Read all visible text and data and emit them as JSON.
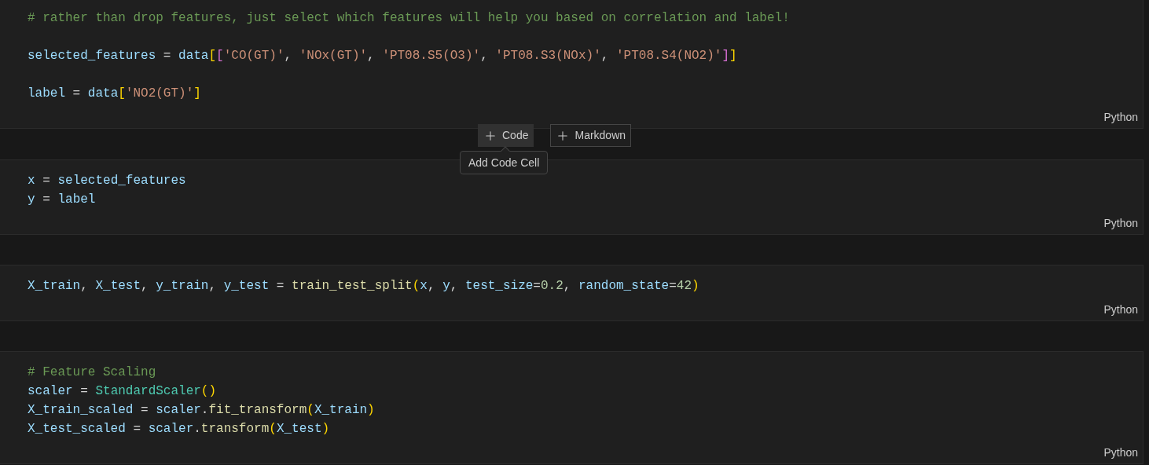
{
  "cells": [
    {
      "language": "Python",
      "lines": [
        {
          "kind": "code",
          "tokens": [
            {
              "kind": "comment",
              "text": "# rather than drop features, just select which features will help you based on correlation and label!"
            }
          ]
        },
        {
          "kind": "blank"
        },
        {
          "kind": "code",
          "tokens": [
            {
              "kind": "var",
              "text": "selected_features"
            },
            {
              "kind": "op",
              "text": " = "
            },
            {
              "kind": "var",
              "text": "data"
            },
            {
              "kind": "b1",
              "text": "["
            },
            {
              "kind": "b2",
              "text": "["
            },
            {
              "kind": "str",
              "text": "'CO(GT)'"
            },
            {
              "kind": "op",
              "text": ", "
            },
            {
              "kind": "str",
              "text": "'NOx(GT)'"
            },
            {
              "kind": "op",
              "text": ", "
            },
            {
              "kind": "str",
              "text": "'PT08.S5(O3)'"
            },
            {
              "kind": "op",
              "text": ", "
            },
            {
              "kind": "str",
              "text": "'PT08.S3(NOx)'"
            },
            {
              "kind": "op",
              "text": ", "
            },
            {
              "kind": "str",
              "text": "'PT08.S4(NO2)'"
            },
            {
              "kind": "b2",
              "text": "]"
            },
            {
              "kind": "b1",
              "text": "]"
            }
          ]
        },
        {
          "kind": "blank"
        },
        {
          "kind": "code",
          "tokens": [
            {
              "kind": "var",
              "text": "label"
            },
            {
              "kind": "op",
              "text": " = "
            },
            {
              "kind": "var",
              "text": "data"
            },
            {
              "kind": "b1",
              "text": "["
            },
            {
              "kind": "str",
              "text": "'NO2(GT)'"
            },
            {
              "kind": "b1",
              "text": "]"
            }
          ]
        }
      ]
    },
    {
      "language": "Python",
      "lines": [
        {
          "kind": "code",
          "tokens": [
            {
              "kind": "var",
              "text": "x"
            },
            {
              "kind": "op",
              "text": " = "
            },
            {
              "kind": "var",
              "text": "selected_features"
            }
          ]
        },
        {
          "kind": "code",
          "tokens": [
            {
              "kind": "var",
              "text": "y"
            },
            {
              "kind": "op",
              "text": " = "
            },
            {
              "kind": "var",
              "text": "label"
            }
          ]
        }
      ]
    },
    {
      "language": "Python",
      "lines": [
        {
          "kind": "code",
          "tokens": [
            {
              "kind": "var",
              "text": "X_train"
            },
            {
              "kind": "op",
              "text": ", "
            },
            {
              "kind": "var",
              "text": "X_test"
            },
            {
              "kind": "op",
              "text": ", "
            },
            {
              "kind": "var",
              "text": "y_train"
            },
            {
              "kind": "op",
              "text": ", "
            },
            {
              "kind": "var",
              "text": "y_test"
            },
            {
              "kind": "op",
              "text": " = "
            },
            {
              "kind": "fn",
              "text": "train_test_split"
            },
            {
              "kind": "b1",
              "text": "("
            },
            {
              "kind": "var",
              "text": "x"
            },
            {
              "kind": "op",
              "text": ", "
            },
            {
              "kind": "var",
              "text": "y"
            },
            {
              "kind": "op",
              "text": ", "
            },
            {
              "kind": "var",
              "text": "test_size"
            },
            {
              "kind": "op",
              "text": "="
            },
            {
              "kind": "num",
              "text": "0.2"
            },
            {
              "kind": "op",
              "text": ", "
            },
            {
              "kind": "var",
              "text": "random_state"
            },
            {
              "kind": "op",
              "text": "="
            },
            {
              "kind": "num",
              "text": "42"
            },
            {
              "kind": "b1",
              "text": ")"
            }
          ]
        }
      ]
    },
    {
      "language": "Python",
      "lines": [
        {
          "kind": "code",
          "tokens": [
            {
              "kind": "comment",
              "text": "# Feature Scaling"
            }
          ]
        },
        {
          "kind": "code",
          "tokens": [
            {
              "kind": "var",
              "text": "scaler"
            },
            {
              "kind": "op",
              "text": " = "
            },
            {
              "kind": "cls",
              "text": "StandardScaler"
            },
            {
              "kind": "b1",
              "text": "()"
            }
          ]
        },
        {
          "kind": "code",
          "tokens": [
            {
              "kind": "var",
              "text": "X_train_scaled"
            },
            {
              "kind": "op",
              "text": " = "
            },
            {
              "kind": "var",
              "text": "scaler"
            },
            {
              "kind": "op",
              "text": "."
            },
            {
              "kind": "fn",
              "text": "fit_transform"
            },
            {
              "kind": "b1",
              "text": "("
            },
            {
              "kind": "var",
              "text": "X_train"
            },
            {
              "kind": "b1",
              "text": ")"
            }
          ]
        },
        {
          "kind": "code",
          "tokens": [
            {
              "kind": "var",
              "text": "X_test_scaled"
            },
            {
              "kind": "op",
              "text": " = "
            },
            {
              "kind": "var",
              "text": "scaler"
            },
            {
              "kind": "op",
              "text": "."
            },
            {
              "kind": "fn",
              "text": "transform"
            },
            {
              "kind": "b1",
              "text": "("
            },
            {
              "kind": "var",
              "text": "X_test"
            },
            {
              "kind": "b1",
              "text": ")"
            }
          ]
        }
      ]
    }
  ],
  "add_toolbar": {
    "buttons": [
      {
        "label": "Code",
        "hovered": true
      },
      {
        "label": "Markdown",
        "hovered": false
      }
    ],
    "tooltip": "Add Code Cell"
  }
}
